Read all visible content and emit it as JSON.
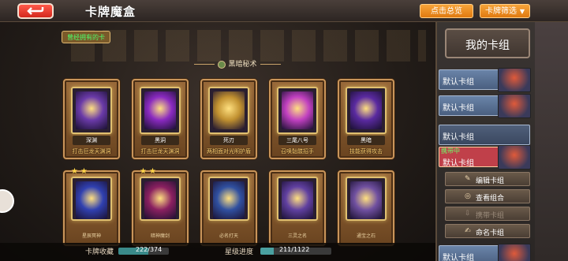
{
  "header": {
    "title": "卡牌魔盒",
    "btn_primary": "点击总览",
    "btn_filter": "卡牌筛选"
  },
  "top_label": "曾经拥有的卡",
  "group_title": "黑暗秘术",
  "cards": [
    {
      "name": "深渊",
      "desc": "打击巨龙天渊洞",
      "art": "#6a3aa8"
    },
    {
      "name": "黑洞",
      "desc": "打击巨龙天渊洞",
      "art": "#8a2ac0"
    },
    {
      "name": "死刃",
      "desc": "两相面对光明护盾",
      "art": "#c09030"
    },
    {
      "name": "三尾八号",
      "desc": "召唤骷髅招手",
      "art": "#c040c0"
    },
    {
      "name": "黑暗",
      "desc": "技能获得攻击",
      "art": "#5a2aa0"
    },
    {
      "name": "星辰冥神",
      "desc": "",
      "art": "#3040b0",
      "stars": 2
    },
    {
      "name": "暗神魔剑",
      "desc": "",
      "art": "#8a2060",
      "stars": 2
    },
    {
      "name": "必名打天",
      "desc": "",
      "art": "#3050a0",
      "stars": 0
    },
    {
      "name": "三灵之名",
      "desc": "",
      "art": "#6040a0",
      "stars": 0
    },
    {
      "name": "通宝之石",
      "desc": "",
      "art": "#7050a0",
      "stars": 0
    }
  ],
  "bottom": {
    "collection_label": "卡牌收藏",
    "collection_value": "222/374",
    "collection_progress": 0.59,
    "star_label": "星级进度",
    "star_value": "211/1122",
    "star_progress": 0.19
  },
  "sidebar": {
    "title": "我的卡组",
    "decks": [
      {
        "name": "默认卡组",
        "carry": ""
      },
      {
        "name": "默认卡组",
        "carry": ""
      },
      {
        "name": "默认卡组",
        "carry": ""
      },
      {
        "name": "默认卡组",
        "carry": "携带中"
      },
      {
        "name": "默认卡组",
        "carry": ""
      }
    ],
    "buttons": [
      {
        "icon": "✎",
        "label": "编辑卡组"
      },
      {
        "icon": "◎",
        "label": "查看组合"
      },
      {
        "icon": "⇩",
        "label": "携带卡组"
      },
      {
        "icon": "✍",
        "label": "命名卡组"
      }
    ]
  }
}
